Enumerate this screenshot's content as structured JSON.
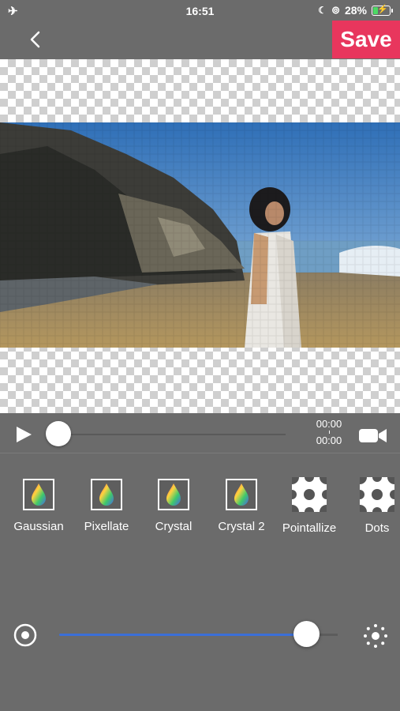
{
  "status_bar": {
    "airplane_icon": "airplane-icon",
    "time": "16:51",
    "battery_percent": "28%",
    "battery_level": 0.28
  },
  "header": {
    "back_icon": "chevron-left-icon",
    "save_label": "Save"
  },
  "player": {
    "current_time": "00:00",
    "total_time": "00:00",
    "progress": 0
  },
  "filters": [
    {
      "label": "Gaussian",
      "icon": "rainbow-drop-icon"
    },
    {
      "label": "Pixellate",
      "icon": "rainbow-drop-icon"
    },
    {
      "label": "Crystal",
      "icon": "rainbow-drop-icon"
    },
    {
      "label": "Crystal 2",
      "icon": "rainbow-drop-icon"
    },
    {
      "label": "Pointallize",
      "icon": "dots-pattern-icon"
    },
    {
      "label": "Dots",
      "icon": "dots-pattern-icon"
    }
  ],
  "intensity": {
    "value": 1.0
  },
  "colors": {
    "accent": "#e8365d",
    "slider": "#3b6fd8",
    "background": "#6b6b6b"
  }
}
